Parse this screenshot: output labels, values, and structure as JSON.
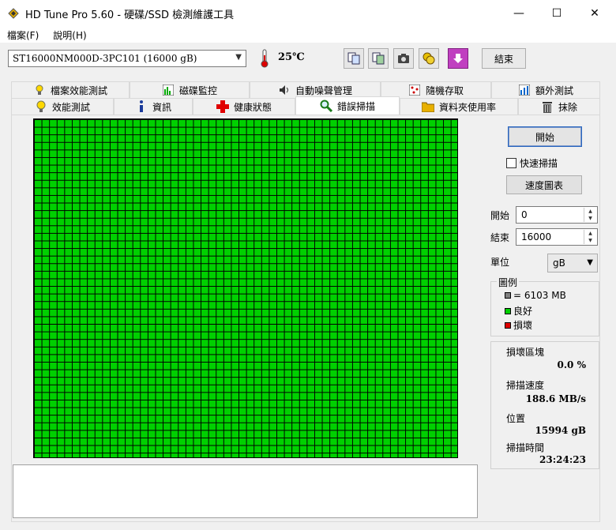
{
  "window": {
    "title": "HD Tune Pro 5.60 - 硬碟/SSD 檢測維護工具",
    "minimize_glyph": "—",
    "maximize_glyph": "☐",
    "close_glyph": "✕"
  },
  "menu": [
    {
      "label": "檔案(F)"
    },
    {
      "label": "說明(H)"
    }
  ],
  "toolbar": {
    "drive": "ST16000NM000D-3PC101 (16000 gB)",
    "temperature": "25℃",
    "icons": [
      "copy-text-icon",
      "copy-screen-icon",
      "camera-icon",
      "options-coins-icon",
      "download-icon"
    ],
    "exit_label": "結束"
  },
  "tabs": {
    "row1": [
      {
        "label": "檔案效能測試",
        "icon": "file-benchmark-icon"
      },
      {
        "label": "磁碟監控",
        "icon": "disk-monitor-icon"
      },
      {
        "label": "自動噪聲管理",
        "icon": "speaker-icon"
      },
      {
        "label": "隨機存取",
        "icon": "random-access-icon"
      },
      {
        "label": "額外測試",
        "icon": "extra-tests-icon"
      }
    ],
    "row2": [
      {
        "label": "效能測試",
        "icon": "lightbulb-icon"
      },
      {
        "label": "資訊",
        "icon": "info-icon"
      },
      {
        "label": "健康狀態",
        "icon": "health-cross-icon"
      },
      {
        "label": "錯誤掃描",
        "icon": "magnifier-icon",
        "active": true
      },
      {
        "label": "資料夾使用率",
        "icon": "folder-icon"
      },
      {
        "label": "抹除",
        "icon": "trash-icon"
      }
    ]
  },
  "scan": {
    "start_label": "開始",
    "quick_scan_label": "快速掃描",
    "quick_scan_checked": false,
    "speed_map_label": "速度圖表",
    "start_field_label": "開始",
    "start_value": "0",
    "end_field_label": "結束",
    "end_value": "16000",
    "unit_label": "單位",
    "unit_value": "gB"
  },
  "legend": {
    "title": "圖例",
    "block_size": "= 6103 MB",
    "good": "良好",
    "damaged": "損壞",
    "colors": {
      "block": "#808080",
      "good": "#00d000",
      "damaged": "#e00000"
    }
  },
  "stats": {
    "damaged_blocks_label": "損壞區塊",
    "damaged_blocks_value": "0.0 %",
    "scan_speed_label": "掃描速度",
    "scan_speed_value": "188.6 MB/s",
    "position_label": "位置",
    "position_value": "15994 gB",
    "scan_time_label": "掃描時間",
    "scan_time_value": "23:24:23"
  },
  "grid": {
    "color_good": "#00d000",
    "block_status": "all good"
  }
}
